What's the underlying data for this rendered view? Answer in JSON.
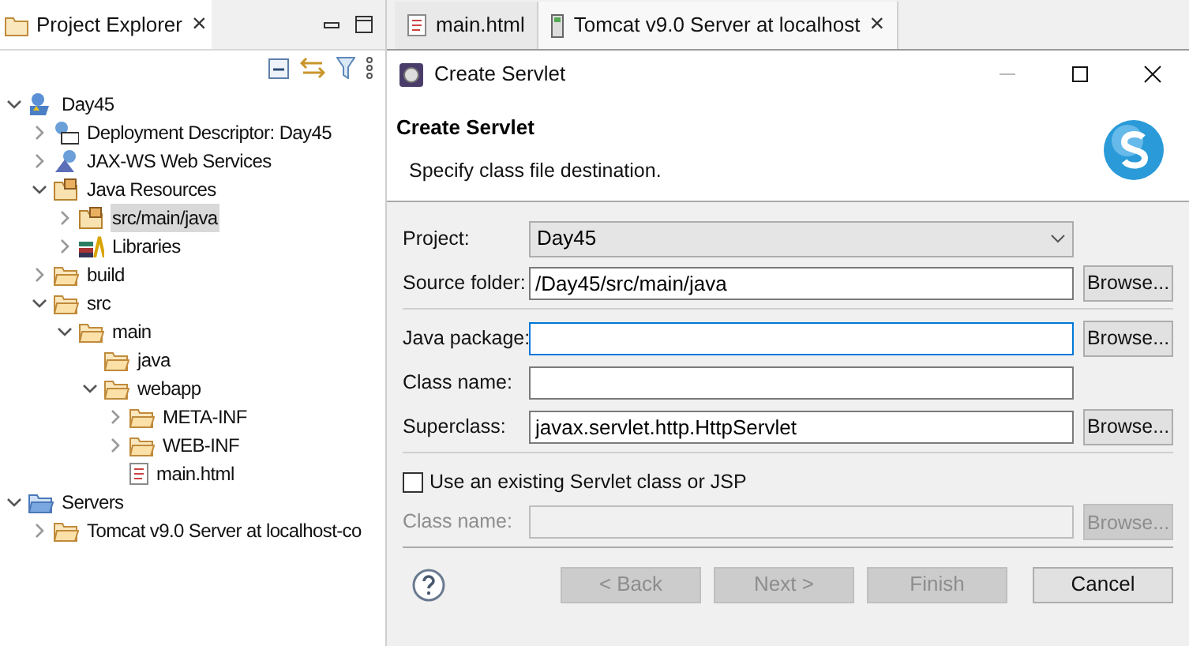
{
  "explorer": {
    "title": "Project Explorer",
    "close": "×"
  },
  "tree": [
    {
      "label": "Day45",
      "kind": "project",
      "expanded": true,
      "selected": false,
      "children": [
        {
          "label": "Deployment Descriptor: Day45",
          "kind": "descriptor",
          "expanded": false,
          "selected": false
        },
        {
          "label": "JAX-WS Web Services",
          "kind": "webservice",
          "expanded": false,
          "selected": false
        },
        {
          "label": "Java Resources",
          "kind": "resources",
          "expanded": true,
          "selected": false,
          "children": [
            {
              "label": "src/main/java",
              "kind": "package",
              "expanded": false,
              "selected": true
            },
            {
              "label": "Libraries",
              "kind": "library",
              "expanded": false,
              "selected": false
            }
          ]
        },
        {
          "label": "build",
          "kind": "folder",
          "expanded": false,
          "selected": false
        },
        {
          "label": "src",
          "kind": "folder",
          "expanded": true,
          "selected": false,
          "children": [
            {
              "label": "main",
              "kind": "folder",
              "expanded": true,
              "selected": false,
              "children": [
                {
                  "label": "java",
                  "kind": "folder",
                  "selected": false
                },
                {
                  "label": "webapp",
                  "kind": "folder",
                  "expanded": true,
                  "selected": false,
                  "children": [
                    {
                      "label": "META-INF",
                      "kind": "folder",
                      "expanded": false,
                      "selected": false
                    },
                    {
                      "label": "WEB-INF",
                      "kind": "folder",
                      "expanded": false,
                      "selected": false
                    },
                    {
                      "label": "main.html",
                      "kind": "file",
                      "selected": false
                    }
                  ]
                }
              ]
            }
          ]
        }
      ]
    },
    {
      "label": "Servers",
      "kind": "servers",
      "expanded": true,
      "selected": false,
      "children": [
        {
          "label": "Tomcat v9.0 Server at localhost-co",
          "kind": "folder",
          "expanded": false,
          "selected": false
        }
      ]
    }
  ],
  "editor_tabs": [
    {
      "label": "main.html",
      "kind": "file",
      "selected": false
    },
    {
      "label": "Tomcat v9.0 Server at localhost",
      "kind": "server",
      "selected": true,
      "close": "×"
    }
  ],
  "dialog": {
    "title": "Create Servlet",
    "heading": "Create Servlet",
    "description": "Specify class file destination.",
    "sections": [
      [
        {
          "label": "Project:",
          "kind": "select",
          "value": "Day45"
        },
        {
          "label": "Source folder:",
          "kind": "text",
          "value": "/Day45/src/main/java",
          "focused": false,
          "browse": "Browse..."
        }
      ],
      [
        {
          "label": "Java package:",
          "kind": "text",
          "focused": true,
          "browse": "Browse..."
        },
        {
          "label": "Class name:",
          "kind": "text",
          "focused": false
        },
        {
          "label": "Superclass:",
          "kind": "text",
          "value": "javax.servlet.http.HttpServlet",
          "focused": false,
          "browse": "Browse..."
        }
      ]
    ],
    "existing": {
      "label": "Use an existing Servlet class or JSP",
      "checked": false
    },
    "existing_row": {
      "label": "Class name:",
      "disabled": true,
      "browse": "Browse..."
    },
    "buttons": [
      {
        "label": "< Back",
        "disabled": true
      },
      {
        "label": "Next >",
        "disabled": true
      },
      {
        "label": "Finish",
        "disabled": true
      },
      {
        "label": "Cancel",
        "disabled": false
      }
    ]
  }
}
